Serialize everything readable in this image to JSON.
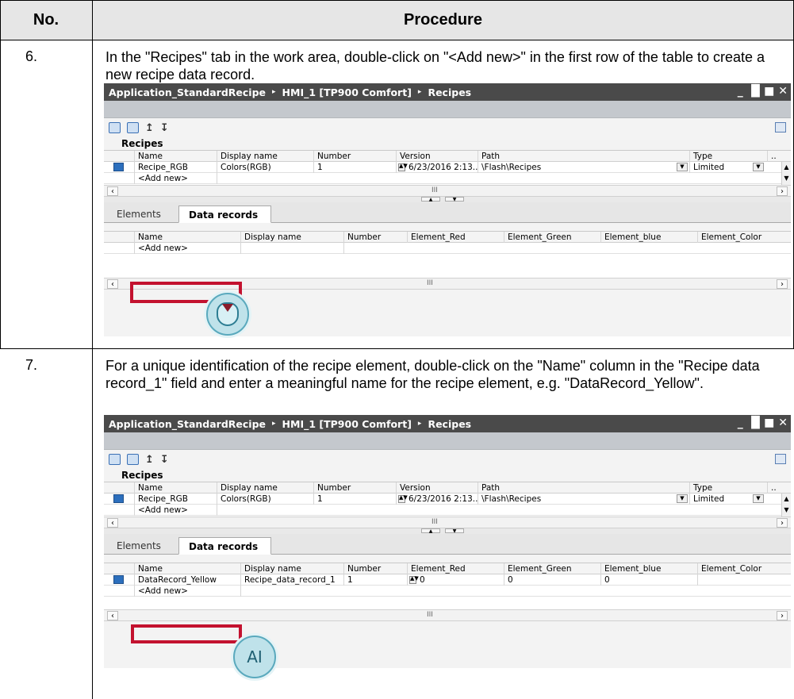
{
  "table": {
    "col_no": "No.",
    "col_procedure": "Procedure"
  },
  "steps": [
    {
      "no": "6.",
      "text": "In the \"Recipes\" tab in the work area, double-click on \"<Add new>\" in the first row of the table to create a new recipe data record."
    },
    {
      "no": "7.",
      "text": "For a unique identification of the recipe element, double-click on the \"Name\" column in the \"Recipe data record_1\" field and enter a meaningful name for the recipe element, e.g. \"DataRecord_Yellow\"."
    }
  ],
  "window": {
    "crumb1": "Application_StandardRecipe",
    "crumb2": "HMI_1 [TP900 Comfort]",
    "crumb3": "Recipes",
    "sep": "▸",
    "controls": "_ ▐▌■ ✕",
    "recipes_title": "Recipes",
    "recipe_cols": [
      "Name",
      "Display name",
      "Number",
      "Version",
      "Path",
      "Type",
      ".."
    ],
    "recipe_row": {
      "name": "Recipe_RGB",
      "display": "Colors(RGB)",
      "number": "1",
      "version": "6/23/2016 2:13...",
      "path": "\\Flash\\Recipes",
      "type": "Limited"
    },
    "add_new": "<Add new>",
    "tab_elements": "Elements",
    "tab_data_records": "Data records",
    "record_cols": [
      "Name",
      "Display name",
      "Number",
      "Element_Red",
      "Element_Green",
      "Element_blue",
      "Element_Color"
    ],
    "record_row": {
      "name": "DataRecord_Yellow",
      "display": "Recipe_data_record_1",
      "number": "1",
      "red": "0",
      "green": "0",
      "blue": "0"
    },
    "scroll_mark": "III"
  },
  "cursor_text_7": "A",
  "colors": {
    "highlight": "#c3122f",
    "title_bar": "#4a4a4a",
    "header_bg": "#e6e6e6"
  }
}
